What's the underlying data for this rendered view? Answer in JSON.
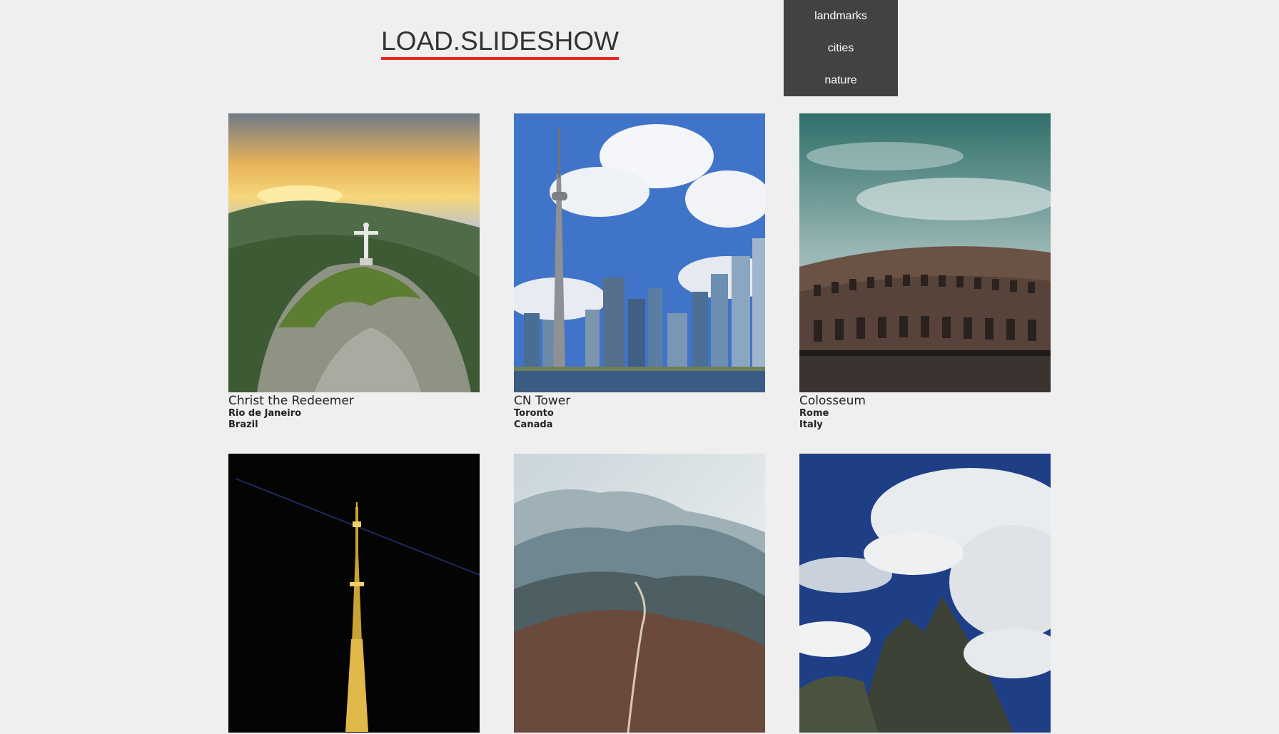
{
  "header": {
    "logo_text": "LOAD.SLIDESHOW",
    "accent_color": "#e8281e"
  },
  "menu": {
    "items": [
      {
        "label": "landmarks"
      },
      {
        "label": "cities"
      },
      {
        "label": "nature"
      }
    ],
    "background": "#424242"
  },
  "gallery": {
    "cards": [
      {
        "name": "Christ the Redeemer",
        "city": "Rio de Janeiro",
        "country": "Brazil"
      },
      {
        "name": "CN Tower",
        "city": "Toronto",
        "country": "Canada"
      },
      {
        "name": "Colosseum",
        "city": "Rome",
        "country": "Italy"
      },
      {
        "name": "",
        "city": "",
        "country": ""
      },
      {
        "name": "",
        "city": "",
        "country": ""
      },
      {
        "name": "",
        "city": "",
        "country": ""
      }
    ]
  }
}
